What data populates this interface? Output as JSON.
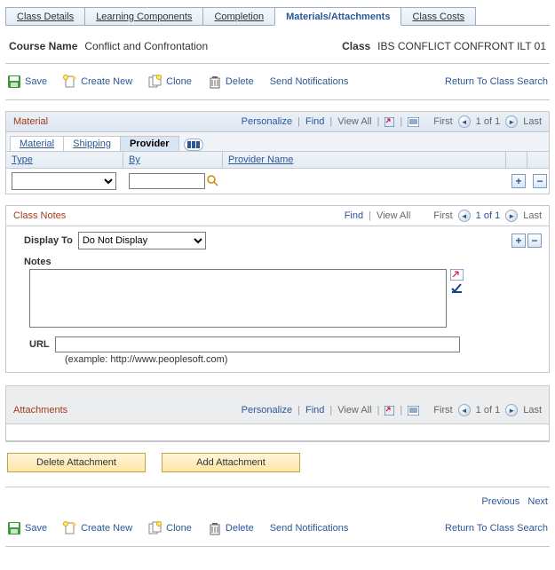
{
  "tabs": {
    "class_details": "Class Details",
    "learning_components": "Learning Components",
    "completion": "Completion",
    "materials_attachments": "Materials/Attachments",
    "class_costs": "Class Costs"
  },
  "header": {
    "course_name_label": "Course Name",
    "course_name": "Conflict and Confrontation",
    "class_label": "Class",
    "class_name": "IBS CONFLICT CONFRONT ILT 01"
  },
  "toolbar": {
    "save": "Save",
    "create_new": "Create New",
    "clone": "Clone",
    "delete": "Delete",
    "send_notifications": "Send Notifications",
    "return_to_search": "Return To Class Search"
  },
  "material": {
    "title": "Material",
    "personalize": "Personalize",
    "find": "Find",
    "view_all": "View All",
    "first": "First",
    "count": "1 of 1",
    "last": "Last",
    "subtabs": {
      "material": "Material",
      "shipping": "Shipping",
      "provider": "Provider"
    },
    "cols": {
      "type": "Type",
      "by": "By",
      "provider_name": "Provider Name"
    },
    "row": {
      "type": "",
      "by": ""
    }
  },
  "class_notes": {
    "title": "Class Notes",
    "find": "Find",
    "view_all": "View All",
    "first": "First",
    "count": "1 of 1",
    "last": "Last",
    "display_to_label": "Display To",
    "display_to_value": "Do Not Display",
    "notes_label": "Notes",
    "notes_value": "",
    "url_label": "URL",
    "url_value": "",
    "url_hint": "(example: http://www.peoplesoft.com)"
  },
  "attachments": {
    "title": "Attachments",
    "personalize": "Personalize",
    "find": "Find",
    "view_all": "View All",
    "first": "First",
    "count": "1 of 1",
    "last": "Last",
    "delete_attachment": "Delete Attachment",
    "add_attachment": "Add Attachment"
  },
  "nav": {
    "previous": "Previous",
    "next": "Next"
  }
}
